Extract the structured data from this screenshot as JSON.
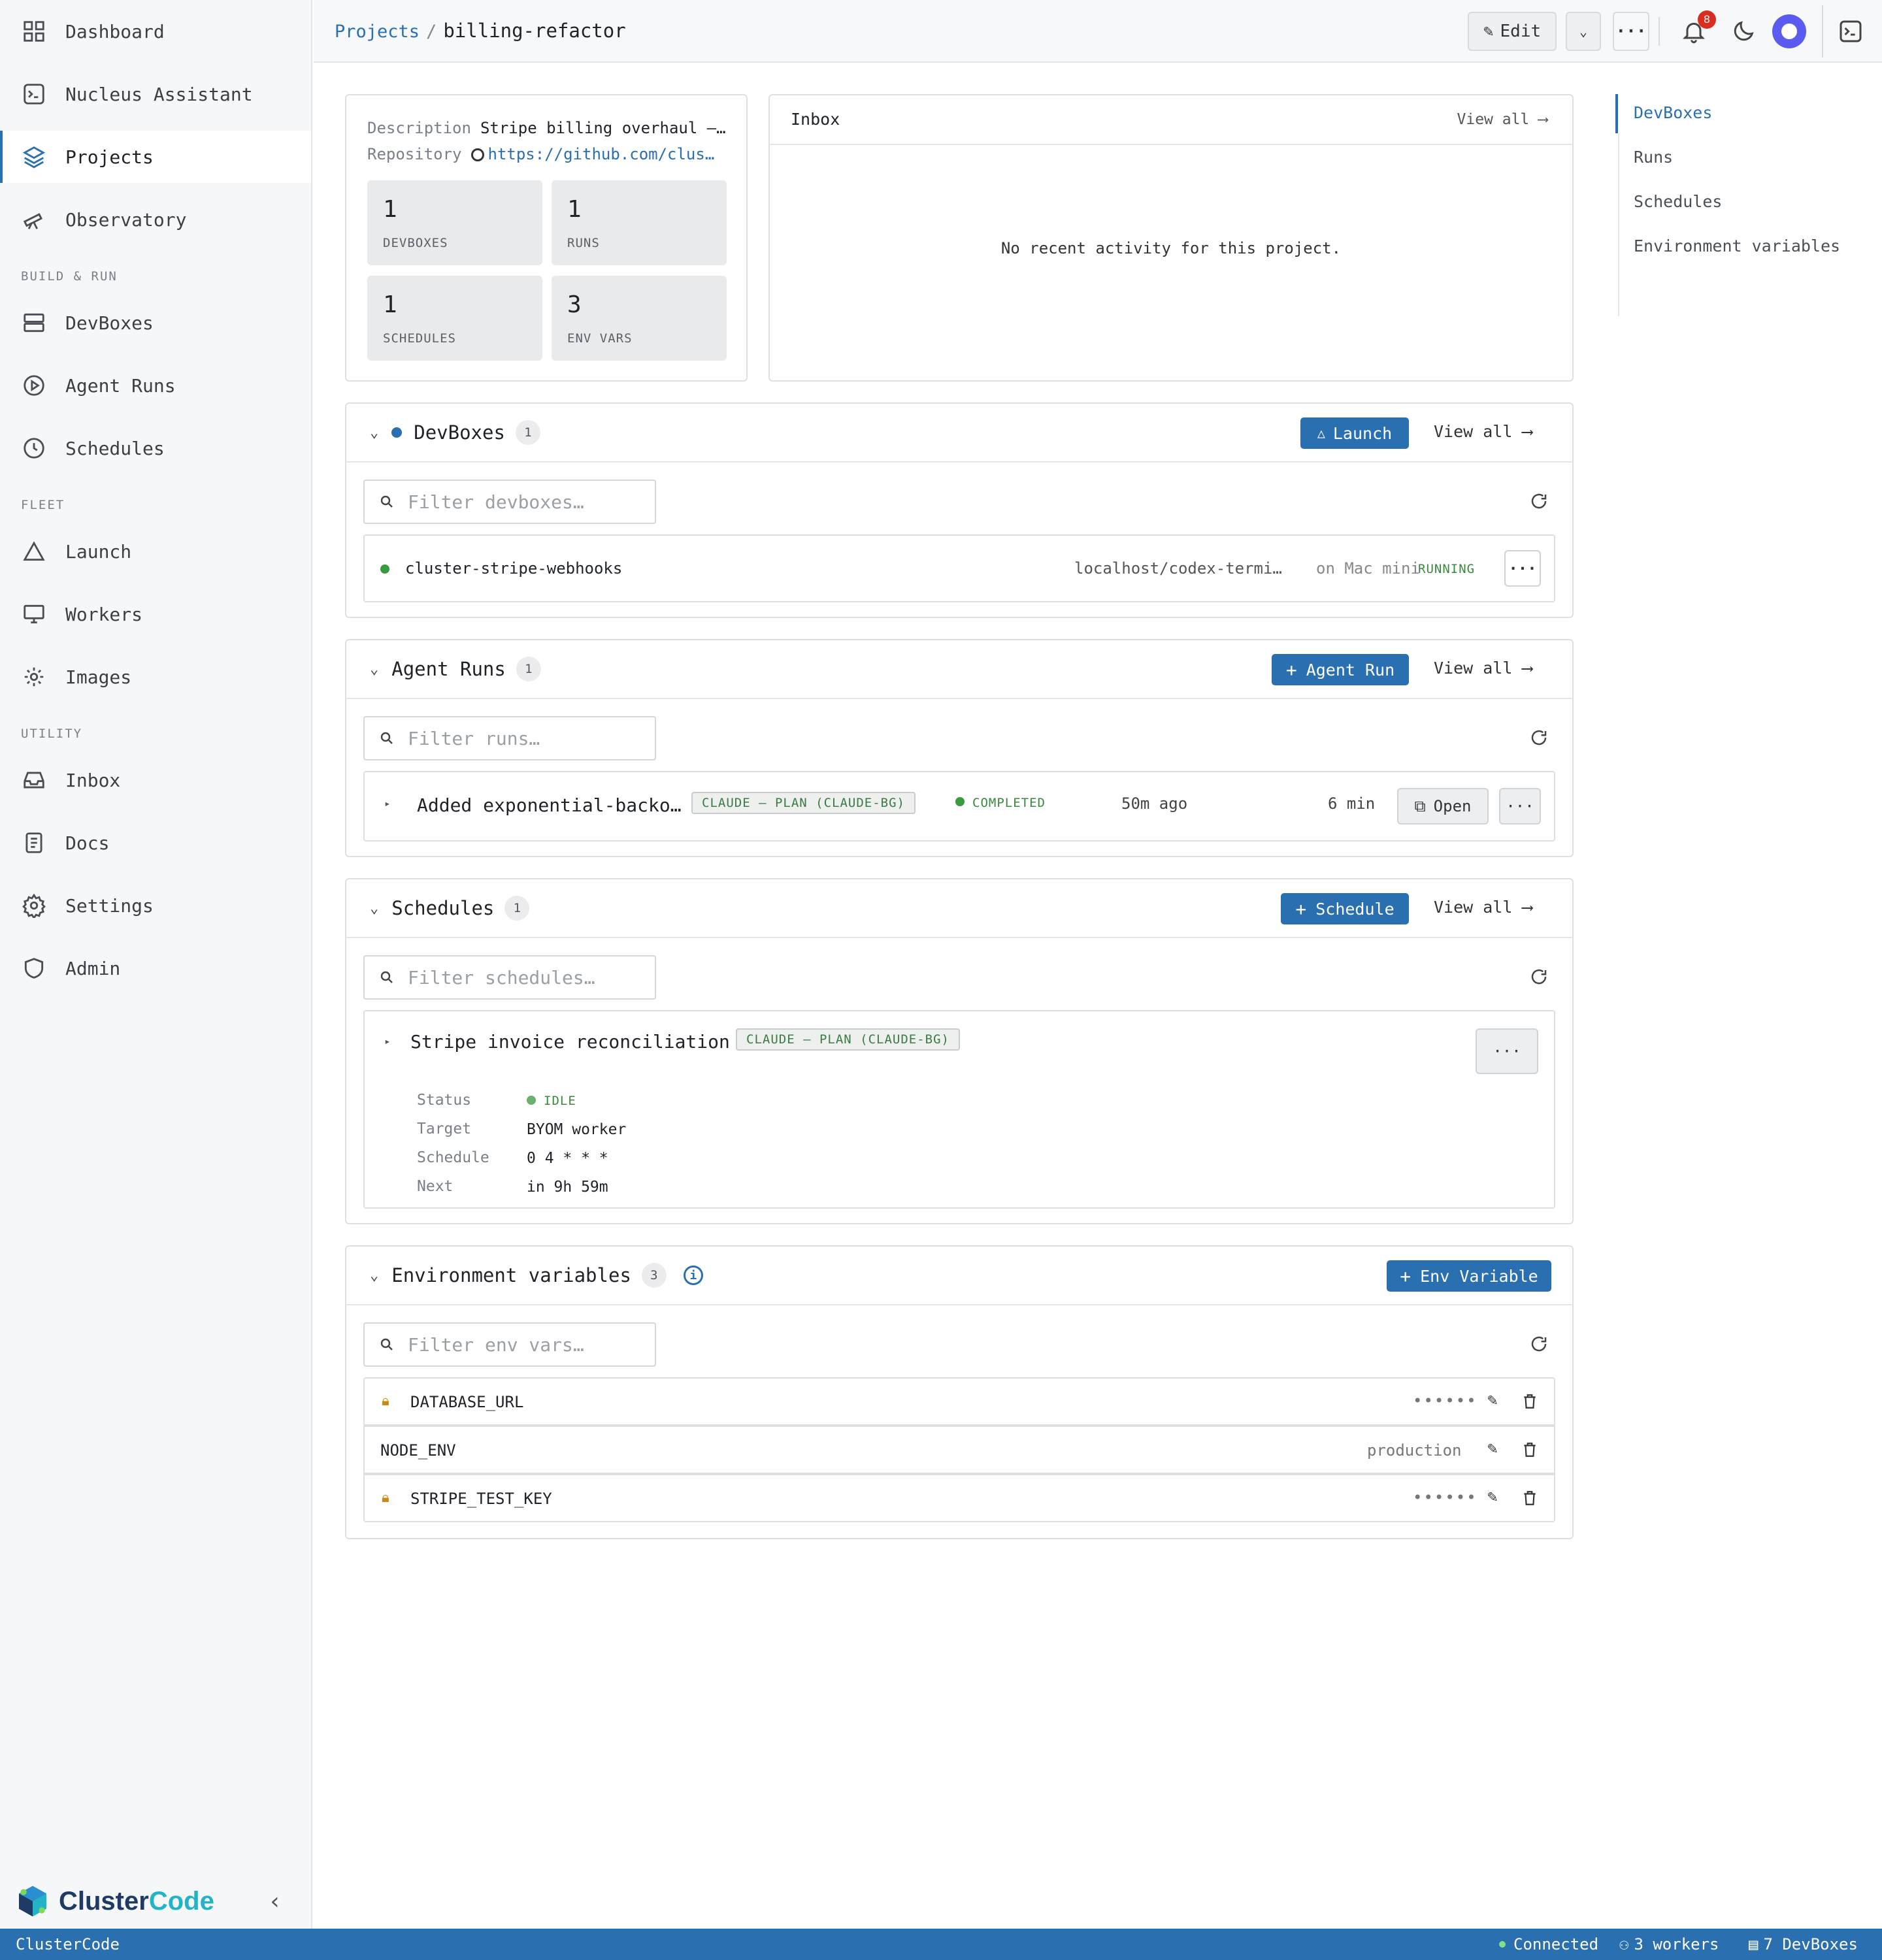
{
  "sidebar": {
    "items": [
      {
        "label": "Dashboard",
        "icon": "dashboard-icon"
      },
      {
        "label": "Nucleus Assistant",
        "icon": "assistant-icon"
      },
      {
        "label": "Projects",
        "icon": "layers-icon"
      },
      {
        "label": "Observatory",
        "icon": "telescope-icon"
      }
    ],
    "sections": [
      "BUILD & RUN",
      "FLEET",
      "UTILITY"
    ],
    "build_items": [
      {
        "label": "DevBoxes",
        "icon": "server-icon"
      },
      {
        "label": "Agent Runs",
        "icon": "play-circle-icon"
      },
      {
        "label": "Schedules",
        "icon": "clock-icon"
      }
    ],
    "fleet_items": [
      {
        "label": "Launch",
        "icon": "triangle-icon"
      },
      {
        "label": "Workers",
        "icon": "monitor-icon"
      },
      {
        "label": "Images",
        "icon": "gear-icon"
      }
    ],
    "utility_items": [
      {
        "label": "Inbox",
        "icon": "inbox-icon"
      },
      {
        "label": "Docs",
        "icon": "document-icon"
      },
      {
        "label": "Settings",
        "icon": "settings-icon"
      },
      {
        "label": "Admin",
        "icon": "shield-icon"
      }
    ],
    "brand_a": "Cluster",
    "brand_b": "Code"
  },
  "topbar": {
    "crumb_root": "Projects",
    "crumb_sep": "/",
    "crumb_current": "billing-refactor",
    "edit_label": "Edit",
    "notification_count": "8"
  },
  "overview": {
    "description_key": "Description",
    "description_value": "Stripe billing overhaul —…",
    "repo_key": "Repository",
    "repo_value": "https://github.com/clus…",
    "stats": [
      {
        "n": "1",
        "l": "DEVBOXES"
      },
      {
        "n": "1",
        "l": "RUNS"
      },
      {
        "n": "1",
        "l": "SCHEDULES"
      },
      {
        "n": "3",
        "l": "ENV VARS"
      }
    ]
  },
  "inbox": {
    "title": "Inbox",
    "view_all": "View all",
    "empty": "No recent activity for this project."
  },
  "devboxes": {
    "title": "DevBoxes",
    "count": "1",
    "launch": "Launch",
    "view_all": "View all",
    "filter_placeholder": "Filter devboxes…",
    "row": {
      "name": "cluster-stripe-webhooks",
      "image": "localhost/codex-termi…",
      "host": "on Mac mini",
      "status": "RUNNING"
    }
  },
  "runs": {
    "title": "Agent Runs",
    "count": "1",
    "add": "Agent Run",
    "view_all": "View all",
    "filter_placeholder": "Filter runs…",
    "row": {
      "name": "Added exponential-backo…",
      "tag": "CLAUDE — PLAN (CLAUDE-BG)",
      "status": "COMPLETED",
      "when": "50m ago",
      "duration": "6 min",
      "open": "Open"
    }
  },
  "schedules": {
    "title": "Schedules",
    "count": "1",
    "add": "Schedule",
    "view_all": "View all",
    "filter_placeholder": "Filter schedules…",
    "row": {
      "name": "Stripe invoice reconciliation",
      "tag": "CLAUDE — PLAN (CLAUDE-BG)",
      "fields": [
        {
          "k": "Status",
          "v": "IDLE"
        },
        {
          "k": "Target",
          "v": "BYOM worker"
        },
        {
          "k": "Schedule",
          "v": "0 4 * * *"
        },
        {
          "k": "Next",
          "v": "in 9h 59m"
        }
      ]
    }
  },
  "env": {
    "title": "Environment variables",
    "count": "3",
    "add": "Env Variable",
    "filter_placeholder": "Filter env vars…",
    "rows": [
      {
        "name": "DATABASE_URL",
        "value": "••••••",
        "secret": true
      },
      {
        "name": "NODE_ENV",
        "value": "production",
        "secret": false
      },
      {
        "name": "STRIPE_TEST_KEY",
        "value": "••••••",
        "secret": true
      }
    ]
  },
  "toc": [
    "DevBoxes",
    "Runs",
    "Schedules",
    "Environment variables"
  ],
  "statusbar": {
    "app": "ClusterCode",
    "connection": "Connected",
    "workers": "3 workers",
    "devboxes": "7 DevBoxes"
  },
  "colors": {
    "accent": "#2a6fb0",
    "success": "#3a9a3e",
    "danger": "#d92d20"
  }
}
